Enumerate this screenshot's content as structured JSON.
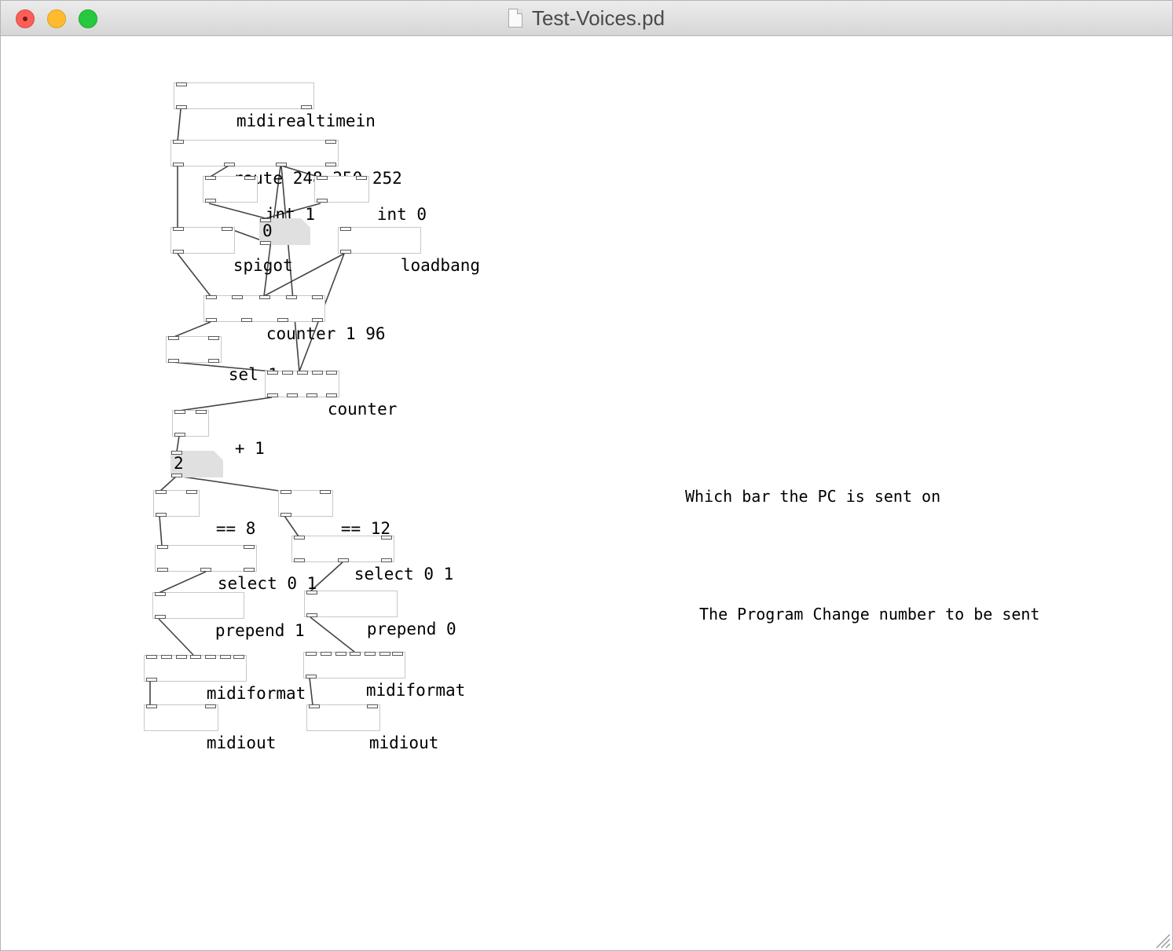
{
  "window": {
    "title": "Test-Voices.pd",
    "buttons": [
      "close",
      "minimize",
      "zoom"
    ]
  },
  "patch": {
    "objects": {
      "midirealtimein": "midirealtimein",
      "route": "route 248 250 252",
      "int1": "int 1",
      "int0": "int 0",
      "spigot": "spigot",
      "loadbang": "loadbang",
      "counter196": "counter 1 96",
      "sel1": "sel 1",
      "counter": "counter",
      "plus1": "+ 1",
      "eq8": "== 8",
      "eq12": "== 12",
      "select01a": "select 0 1",
      "select01b": "select 0 1",
      "prepend1": "prepend 1",
      "prepend0": "prepend 0",
      "midiformatA": "midiformat",
      "midiformatB": "midiformat",
      "midioutA": "midiout",
      "midioutB": "midiout"
    },
    "number_boxes": {
      "toggle_state": "0",
      "bar_count": "2"
    },
    "comments": {
      "bar_comment": "Which bar the PC is sent on",
      "pc_comment": "The Program Change number to be sent"
    }
  }
}
